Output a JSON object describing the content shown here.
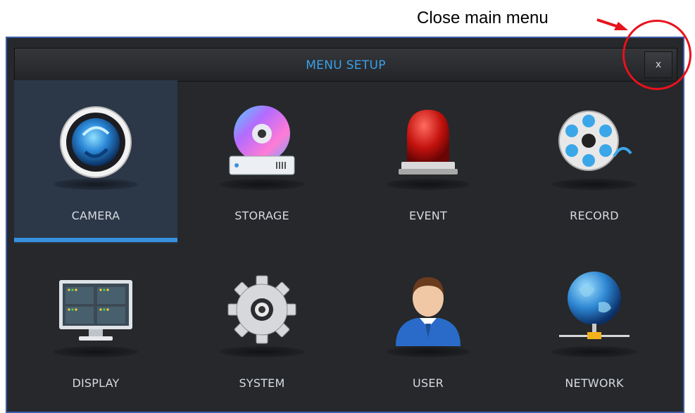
{
  "annotation": {
    "text": "Close main menu",
    "color": "#e8121b"
  },
  "window": {
    "title": "MENU SETUP",
    "close_label": "x",
    "accent": "#3aa0e8",
    "selected_color": "#3891e0"
  },
  "menu": {
    "items": [
      {
        "label": "CAMERA",
        "icon": "camera-lens-icon",
        "selected": true
      },
      {
        "label": "STORAGE",
        "icon": "disc-drive-icon",
        "selected": false
      },
      {
        "label": "EVENT",
        "icon": "alarm-siren-icon",
        "selected": false
      },
      {
        "label": "RECORD",
        "icon": "film-reel-icon",
        "selected": false
      },
      {
        "label": "DISPLAY",
        "icon": "monitor-icon",
        "selected": false
      },
      {
        "label": "SYSTEM",
        "icon": "gear-icon",
        "selected": false
      },
      {
        "label": "USER",
        "icon": "user-icon",
        "selected": false
      },
      {
        "label": "NETWORK",
        "icon": "globe-network-icon",
        "selected": false
      }
    ]
  }
}
